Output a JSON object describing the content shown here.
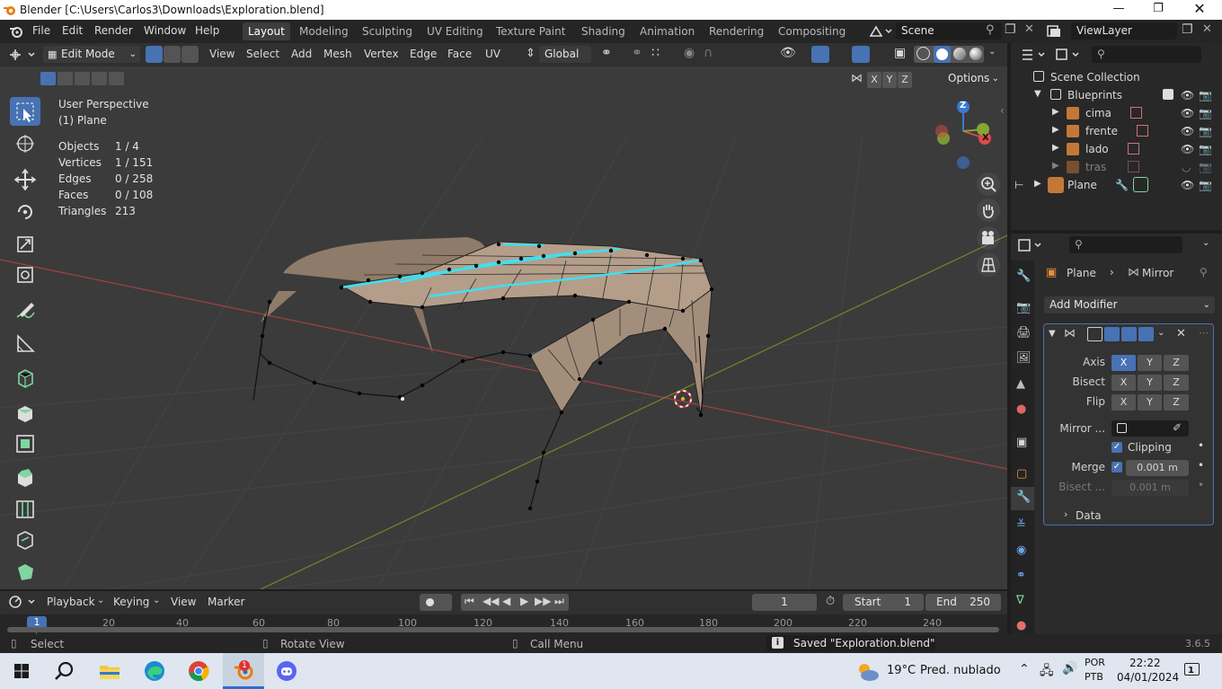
{
  "window": {
    "title": "Blender [C:\\Users\\Carlos3\\Downloads\\Exploration.blend]"
  },
  "menu": [
    "File",
    "Edit",
    "Render",
    "Window",
    "Help"
  ],
  "workspaces": [
    "Layout",
    "Modeling",
    "Sculpting",
    "UV Editing",
    "Texture Paint",
    "Shading",
    "Animation",
    "Rendering",
    "Compositing"
  ],
  "scene": {
    "name": "Scene",
    "view_layer": "ViewLayer"
  },
  "viewport_header": {
    "mode": "Edit Mode",
    "menus": [
      "View",
      "Select",
      "Add",
      "Mesh",
      "Vertex",
      "Edge",
      "Face",
      "UV"
    ],
    "orientation": "Global",
    "options": "Options",
    "xyz": [
      "X",
      "Y",
      "Z"
    ]
  },
  "overlay": {
    "view_name": "User Perspective",
    "object_name": "(1) Plane",
    "stats": [
      {
        "label": "Objects",
        "value": "1 / 4"
      },
      {
        "label": "Vertices",
        "value": "1 / 151"
      },
      {
        "label": "Edges",
        "value": "0 / 258"
      },
      {
        "label": "Faces",
        "value": "0 / 108"
      },
      {
        "label": "Triangles",
        "value": "213"
      }
    ]
  },
  "gizmo": {
    "x": "X",
    "y": "Y",
    "z": "Z"
  },
  "timeline": {
    "menus": [
      "Playback",
      "Keying",
      "View",
      "Marker"
    ],
    "current_frame": "1",
    "start_label": "Start",
    "start": "1",
    "end_label": "End",
    "end": "250",
    "ruler": [
      "1",
      "20",
      "40",
      "60",
      "80",
      "100",
      "120",
      "140",
      "160",
      "180",
      "200",
      "220",
      "240"
    ]
  },
  "statusbar": {
    "select": "Select",
    "rotate": "Rotate View",
    "menu": "Call Menu",
    "message": "Saved \"Exploration.blend\"",
    "version": "3.6.5"
  },
  "outliner": {
    "root": "Scene Collection",
    "collection": "Blueprints",
    "items": [
      "cima",
      "frente",
      "lado",
      "tras"
    ],
    "object": "Plane"
  },
  "properties": {
    "breadcrumb_object": "Plane",
    "breadcrumb_modifier": "Mirror",
    "add_modifier": "Add Modifier",
    "axis_label": "Axis",
    "bisect_label": "Bisect",
    "flip_label": "Flip",
    "mirror_object_label": "Mirror ...",
    "clipping_label": "Clipping",
    "merge_label": "Merge",
    "merge_value": "0.001 m",
    "bisect_dist_label": "Bisect ...",
    "bisect_dist_value": "0.001 m",
    "data_label": "Data",
    "xyz": [
      "X",
      "Y",
      "Z"
    ]
  },
  "taskbar": {
    "weather_temp": "19°C",
    "weather_text": "Pred. nublado",
    "lang1": "POR",
    "lang2": "PTB",
    "time": "22:22",
    "date": "04/01/2024",
    "notif_count": "1"
  },
  "colors": {
    "accent": "#4772b3",
    "mesh_face": "#b8a18c",
    "selected_edge": "#3ee0f0",
    "x_axis": "#c84a4a",
    "y_axis": "#86a832"
  }
}
